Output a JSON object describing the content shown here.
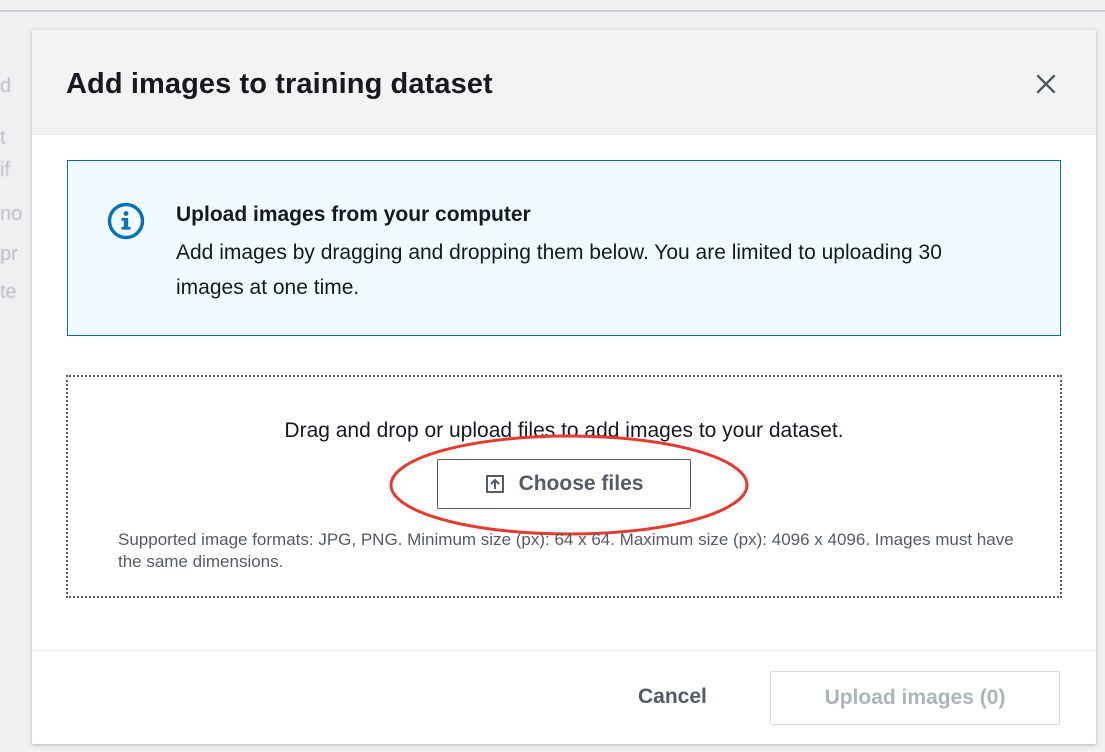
{
  "modal": {
    "title": "Add images to training dataset",
    "close_icon": "close-icon"
  },
  "info": {
    "icon": "info-icon",
    "title": "Upload images from your computer",
    "body": "Add images by dragging and dropping them below. You are limited to uploading 30 images at one time."
  },
  "dropzone": {
    "instruction": "Drag and drop or upload files to add images to your dataset.",
    "choose_button_icon": "upload-icon",
    "choose_button_label": "Choose files",
    "formats_text": "Supported image formats: JPG, PNG. Minimum size (px): 64 x 64. Maximum size (px): 4096 x 4096. Images must have the same dimensions."
  },
  "footer": {
    "cancel_label": "Cancel",
    "upload_label": "Upload images (0)"
  },
  "colors": {
    "info_border": "#0073bb",
    "info_background": "#f1faff",
    "highlight_ellipse": "#e8392f",
    "disabled_text": "#aab7b8"
  }
}
